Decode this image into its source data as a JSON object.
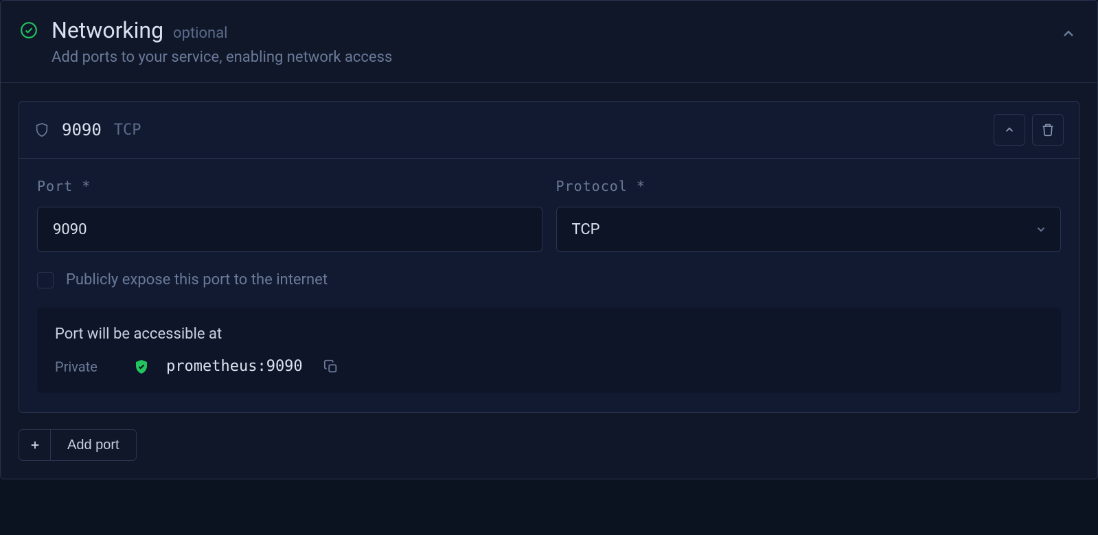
{
  "section": {
    "title": "Networking",
    "optional": "optional",
    "subtitle": "Add ports to your service, enabling network access"
  },
  "port_card": {
    "port_display": "9090",
    "protocol_display": "TCP"
  },
  "form": {
    "port_label": "Port *",
    "port_value": "9090",
    "protocol_label": "Protocol *",
    "protocol_value": "TCP",
    "expose_label": "Publicly expose this port to the internet"
  },
  "access": {
    "title": "Port will be accessible at",
    "private_label": "Private",
    "url": "prometheus:9090"
  },
  "add_port_label": "Add port"
}
